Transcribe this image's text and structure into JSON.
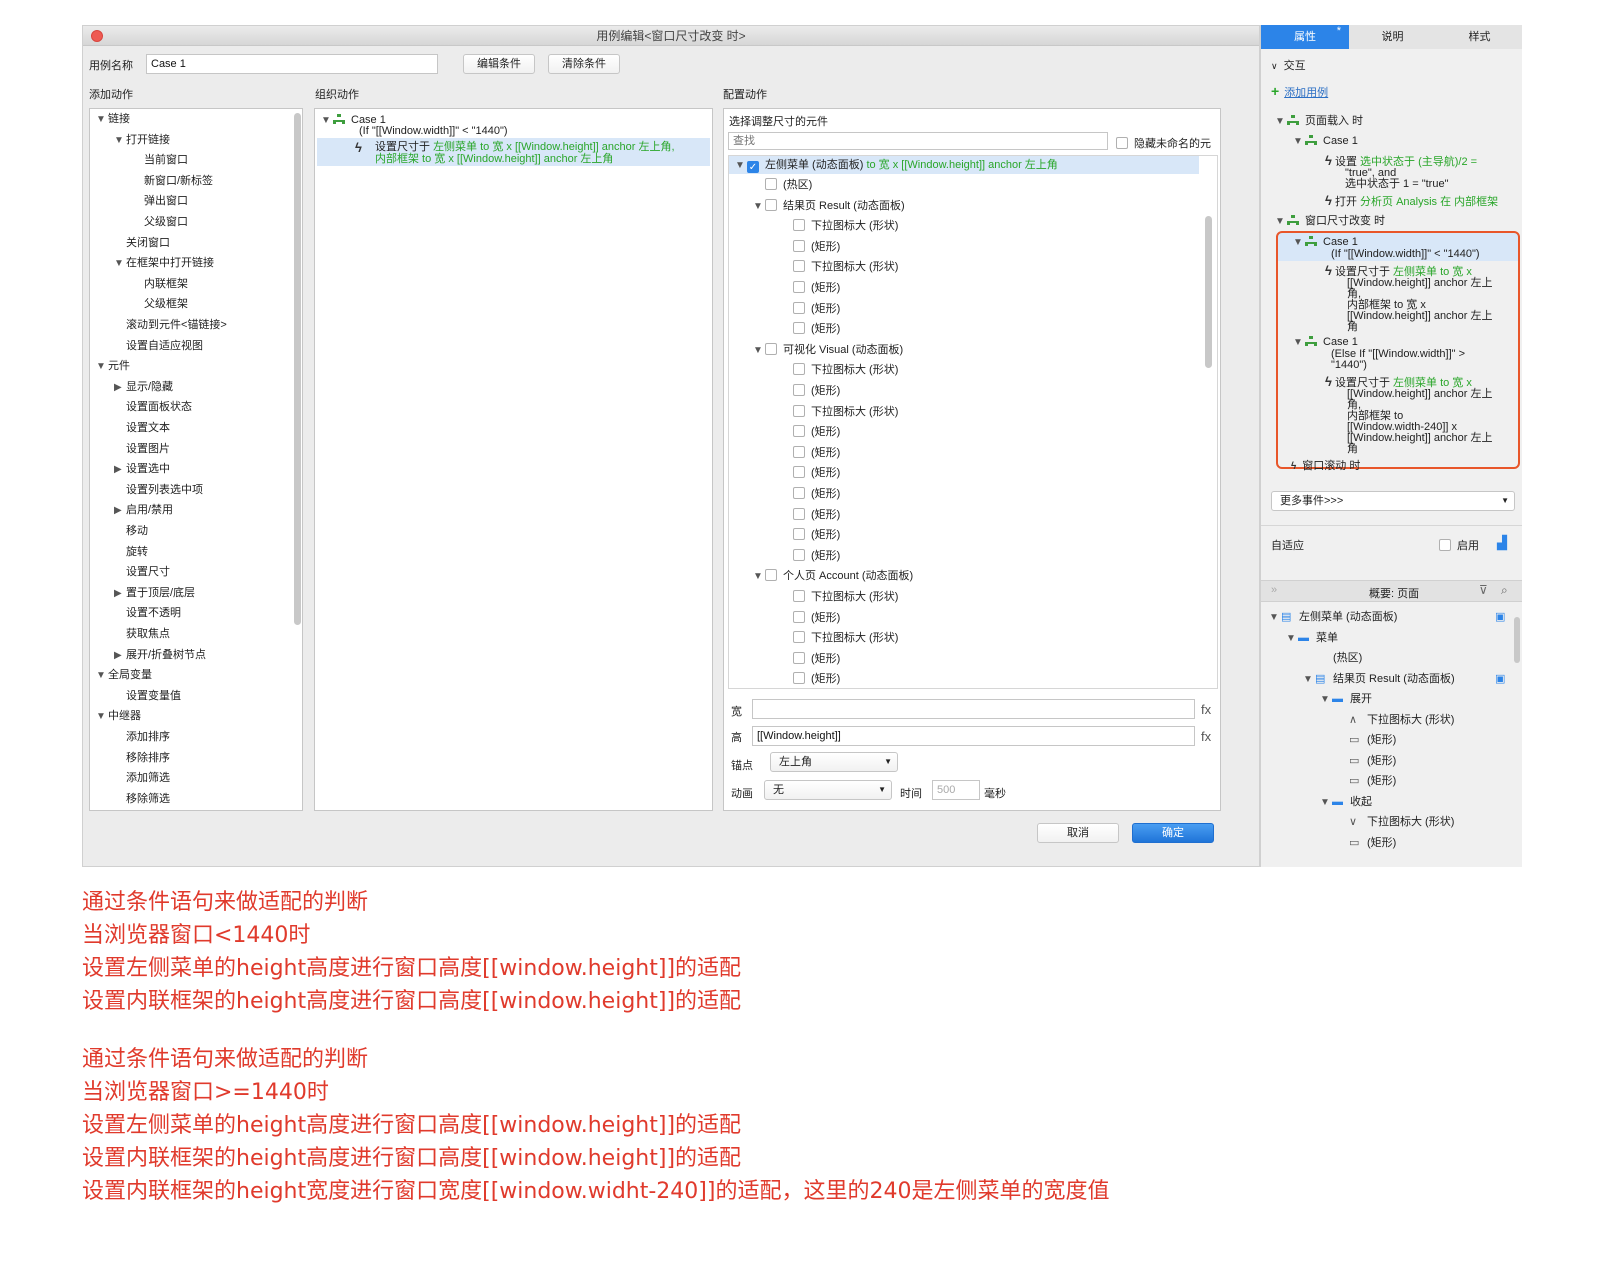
{
  "dialog": {
    "title": "用例编辑<窗口尺寸改变 时>",
    "case_name_label": "用例名称",
    "case_name_value": "Case 1",
    "edit_condition": "编辑条件",
    "clear_condition": "清除条件",
    "add_action_label": "添加动作",
    "organize_action_label": "组织动作",
    "config_action_label": "配置动作",
    "cancel": "取消",
    "ok": "确定"
  },
  "actions_tree": [
    {
      "text": "链接",
      "level": 0,
      "tri": "▼"
    },
    {
      "text": "打开链接",
      "level": 1,
      "tri": "▼"
    },
    {
      "text": "当前窗口",
      "level": 2,
      "tri": ""
    },
    {
      "text": "新窗口/新标签",
      "level": 2,
      "tri": ""
    },
    {
      "text": "弹出窗口",
      "level": 2,
      "tri": ""
    },
    {
      "text": "父级窗口",
      "level": 2,
      "tri": ""
    },
    {
      "text": "关闭窗口",
      "level": 1,
      "tri": ""
    },
    {
      "text": "在框架中打开链接",
      "level": 1,
      "tri": "▼"
    },
    {
      "text": "内联框架",
      "level": 2,
      "tri": ""
    },
    {
      "text": "父级框架",
      "level": 2,
      "tri": ""
    },
    {
      "text": "滚动到元件<锚链接>",
      "level": 1,
      "tri": ""
    },
    {
      "text": "设置自适应视图",
      "level": 1,
      "tri": ""
    },
    {
      "text": "元件",
      "level": 0,
      "tri": "▼"
    },
    {
      "text": "显示/隐藏",
      "level": 1,
      "tri": "▶"
    },
    {
      "text": "设置面板状态",
      "level": 1,
      "tri": ""
    },
    {
      "text": "设置文本",
      "level": 1,
      "tri": ""
    },
    {
      "text": "设置图片",
      "level": 1,
      "tri": ""
    },
    {
      "text": "设置选中",
      "level": 1,
      "tri": "▶"
    },
    {
      "text": "设置列表选中项",
      "level": 1,
      "tri": ""
    },
    {
      "text": "启用/禁用",
      "level": 1,
      "tri": "▶"
    },
    {
      "text": "移动",
      "level": 1,
      "tri": ""
    },
    {
      "text": "旋转",
      "level": 1,
      "tri": ""
    },
    {
      "text": "设置尺寸",
      "level": 1,
      "tri": ""
    },
    {
      "text": "置于顶层/底层",
      "level": 1,
      "tri": "▶"
    },
    {
      "text": "设置不透明",
      "level": 1,
      "tri": ""
    },
    {
      "text": "获取焦点",
      "level": 1,
      "tri": ""
    },
    {
      "text": "展开/折叠树节点",
      "level": 1,
      "tri": "▶"
    },
    {
      "text": "全局变量",
      "level": 0,
      "tri": "▼"
    },
    {
      "text": "设置变量值",
      "level": 1,
      "tri": ""
    },
    {
      "text": "中继器",
      "level": 0,
      "tri": "▼"
    },
    {
      "text": "添加排序",
      "level": 1,
      "tri": ""
    },
    {
      "text": "移除排序",
      "level": 1,
      "tri": ""
    },
    {
      "text": "添加筛选",
      "level": 1,
      "tri": ""
    },
    {
      "text": "移除筛选",
      "level": 1,
      "tri": ""
    }
  ],
  "organize": {
    "case_title": "Case 1",
    "case_condition": "(If \"[[Window.width]]\" < \"1440\")",
    "action_prefix": "设置尺寸于",
    "action_line1": "左侧菜单 to 宽 x [[Window.height]] anchor 左上角,",
    "action_line2": "内部框架 to 宽 x [[Window.height]] anchor 左上角"
  },
  "config": {
    "select_label": "选择调整尺寸的元件",
    "search_placeholder": "查找",
    "hide_unnamed": "隐藏未命名的元",
    "first_item_name": "左侧菜单 (动态面板)",
    "first_item_detail": "to 宽 x [[Window.height]] anchor 左上角",
    "items": [
      {
        "text": "(热区)",
        "level": 1,
        "tri": ""
      },
      {
        "text": "结果页 Result (动态面板)",
        "level": 1,
        "tri": "▼"
      },
      {
        "text": "下拉图标大 (形状)",
        "level": 2,
        "tri": ""
      },
      {
        "text": "(矩形)",
        "level": 2,
        "tri": ""
      },
      {
        "text": "下拉图标大 (形状)",
        "level": 2,
        "tri": ""
      },
      {
        "text": "(矩形)",
        "level": 2,
        "tri": ""
      },
      {
        "text": "(矩形)",
        "level": 2,
        "tri": ""
      },
      {
        "text": "(矩形)",
        "level": 2,
        "tri": ""
      },
      {
        "text": "可视化 Visual (动态面板)",
        "level": 1,
        "tri": "▼"
      },
      {
        "text": "下拉图标大 (形状)",
        "level": 2,
        "tri": ""
      },
      {
        "text": "(矩形)",
        "level": 2,
        "tri": ""
      },
      {
        "text": "下拉图标大 (形状)",
        "level": 2,
        "tri": ""
      },
      {
        "text": "(矩形)",
        "level": 2,
        "tri": ""
      },
      {
        "text": "(矩形)",
        "level": 2,
        "tri": ""
      },
      {
        "text": "(矩形)",
        "level": 2,
        "tri": ""
      },
      {
        "text": "(矩形)",
        "level": 2,
        "tri": ""
      },
      {
        "text": "(矩形)",
        "level": 2,
        "tri": ""
      },
      {
        "text": "(矩形)",
        "level": 2,
        "tri": ""
      },
      {
        "text": "(矩形)",
        "level": 2,
        "tri": ""
      },
      {
        "text": "个人页 Account (动态面板)",
        "level": 1,
        "tri": "▼"
      },
      {
        "text": "下拉图标大 (形状)",
        "level": 2,
        "tri": ""
      },
      {
        "text": "(矩形)",
        "level": 2,
        "tri": ""
      },
      {
        "text": "下拉图标大 (形状)",
        "level": 2,
        "tri": ""
      },
      {
        "text": "(矩形)",
        "level": 2,
        "tri": ""
      },
      {
        "text": "(矩形)",
        "level": 2,
        "tri": ""
      }
    ],
    "width_label": "宽",
    "width_value": "",
    "height_label": "高",
    "height_value": "[[Window.height]]",
    "fx": "fx",
    "anchor_label": "锚点",
    "anchor_value": "左上角",
    "anim_label": "动画",
    "anim_value": "无",
    "time_label": "时间",
    "time_value": "500",
    "ms_label": "毫秒"
  },
  "right": {
    "tab_props": "属性",
    "tab_notes": "说明",
    "tab_style": "样式",
    "tab_props_mark": "*",
    "interaction": "交互",
    "add_case": "添加用例",
    "page_load": "页面载入 时",
    "case1": "Case 1",
    "set_label": "设置",
    "pl_set_text": "选中状态于 (主导航)/2 =",
    "pl_set_text2": "\"true\", and",
    "pl_set_text3": "选中状态于 1 = \"true\"",
    "open_label": "打开",
    "pl_open_text": "分析页 Analysis 在 内部框架",
    "resize_event": "窗口尺寸改变 时",
    "c1_title": "Case 1",
    "c1_cond": "(If \"[[Window.width]]\" < \"1440\")",
    "c1_act": "设置尺寸于",
    "c1_a1": "左侧菜单 to 宽 x",
    "c1_a2": "[[Window.height]] anchor 左上",
    "c1_a3": "角,",
    "c1_a4": "内部框架 to 宽 x",
    "c1_a5": "[[Window.height]] anchor 左上",
    "c1_a6": "角",
    "c2_title": "Case 1",
    "c2_cond1": "(Else If \"[[Window.width]]\" >",
    "c2_cond2": "\"1440\")",
    "c2_act": "设置尺寸于",
    "c2_a1": "左侧菜单 to 宽 x",
    "c2_a2": "[[Window.height]] anchor 左上",
    "c2_a3": "角,",
    "c2_a4": "内部框架 to",
    "c2_a5": "[[Window.width-240]] x",
    "c2_a6": "[[Window.height]] anchor 左上",
    "c2_a7": "角",
    "scroll_event": "窗口滚动 时",
    "more_events": "更多事件>>>",
    "adaptive": "自适应",
    "enable": "启用",
    "outline_title": "概要: 页面",
    "outline": [
      {
        "text": "左侧菜单 (动态面板)",
        "level": 0,
        "tri": "▼",
        "icon": "panel"
      },
      {
        "text": "菜单",
        "level": 1,
        "tri": "▼",
        "icon": "state"
      },
      {
        "text": "(热区)",
        "level": 2,
        "tri": "",
        "icon": "hotspot"
      },
      {
        "text": "结果页 Result (动态面板)",
        "level": 2,
        "tri": "▼",
        "icon": "panel"
      },
      {
        "text": "展开",
        "level": 3,
        "tri": "▼",
        "icon": "state"
      },
      {
        "text": "下拉图标大 (形状)",
        "level": 4,
        "tri": "",
        "icon": "caret-up"
      },
      {
        "text": "(矩形)",
        "level": 4,
        "tri": "",
        "icon": "rect"
      },
      {
        "text": "(矩形)",
        "level": 4,
        "tri": "",
        "icon": "rect"
      },
      {
        "text": "(矩形)",
        "level": 4,
        "tri": "",
        "icon": "rect"
      },
      {
        "text": "收起",
        "level": 3,
        "tri": "▼",
        "icon": "state"
      },
      {
        "text": "下拉图标大 (形状)",
        "level": 4,
        "tri": "",
        "icon": "caret-down"
      },
      {
        "text": "(矩形)",
        "level": 4,
        "tri": "",
        "icon": "rect"
      }
    ]
  },
  "notes": [
    "通过条件语句来做适配的判断",
    "当浏览器窗口<1440时",
    "设置左侧菜单的height高度进行窗口高度[[window.height]]的适配",
    "设置内联框架的height高度进行窗口高度[[window.height]]的适配",
    "通过条件语句来做适配的判断",
    "当浏览器窗口>=1440时",
    "设置左侧菜单的height高度进行窗口高度[[window.height]]的适配",
    "设置内联框架的height高度进行窗口高度[[window.height]]的适配",
    "设置内联框架的height宽度进行窗口宽度[[window.widht-240]]的适配，这里的240是左侧菜单的宽度值"
  ],
  "colors": {
    "accent": "#2c84e8",
    "note_red": "#e03a2c",
    "highlight": "#e8562a",
    "case_green": "#2aa62a"
  }
}
